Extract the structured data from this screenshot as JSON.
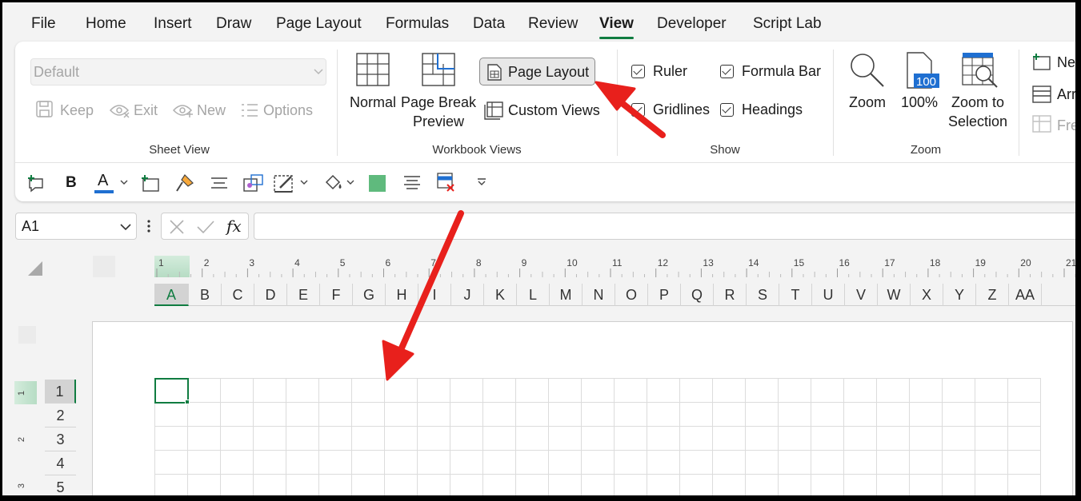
{
  "menu": {
    "tabs": [
      "File",
      "Home",
      "Insert",
      "Draw",
      "Page Layout",
      "Formulas",
      "Data",
      "Review",
      "View",
      "Developer",
      "Script Lab"
    ],
    "active_tab": "View"
  },
  "ribbon": {
    "sheet_view": {
      "select_value": "Default",
      "keep": "Keep",
      "exit": "Exit",
      "new": "New",
      "options": "Options",
      "label": "Sheet View"
    },
    "workbook_views": {
      "normal": "Normal",
      "page_break_line1": "Page Break",
      "page_break_line2": "Preview",
      "page_layout": "Page Layout",
      "custom_views": "Custom Views",
      "label": "Workbook Views"
    },
    "show": {
      "ruler": "Ruler",
      "formula_bar": "Formula Bar",
      "gridlines": "Gridlines",
      "headings": "Headings",
      "label": "Show"
    },
    "zoom": {
      "zoom": "Zoom",
      "hundred": "100%",
      "hundred_icon_text": "100",
      "selection_line1": "Zoom to",
      "selection_line2": "Selection",
      "label": "Zoom"
    },
    "window": {
      "new": "New",
      "arrange": "Arr",
      "freeze": "Fre"
    },
    "qat": {
      "bold": "B"
    }
  },
  "formula_bar": {
    "name_box": "A1",
    "fx": "fx",
    "value": ""
  },
  "sheet": {
    "columns": [
      "A",
      "B",
      "C",
      "D",
      "E",
      "F",
      "G",
      "H",
      "I",
      "J",
      "K",
      "L",
      "M",
      "N",
      "O",
      "P",
      "Q",
      "R",
      "S",
      "T",
      "U",
      "V",
      "W",
      "X",
      "Y",
      "Z",
      "AA"
    ],
    "selected_column": "A",
    "rows": [
      "1",
      "2",
      "3",
      "4",
      "5"
    ],
    "selected_row": "1",
    "ruler_numbers": [
      "1",
      "2",
      "3",
      "4",
      "5",
      "6",
      "7",
      "8",
      "9",
      "10",
      "11",
      "12",
      "13",
      "14",
      "15",
      "16",
      "17",
      "18",
      "19",
      "20",
      "21"
    ],
    "vruler_numbers": [
      "1",
      "2",
      "3"
    ]
  },
  "colors": {
    "accent": "#107c41",
    "arrow": "#e8201c"
  }
}
